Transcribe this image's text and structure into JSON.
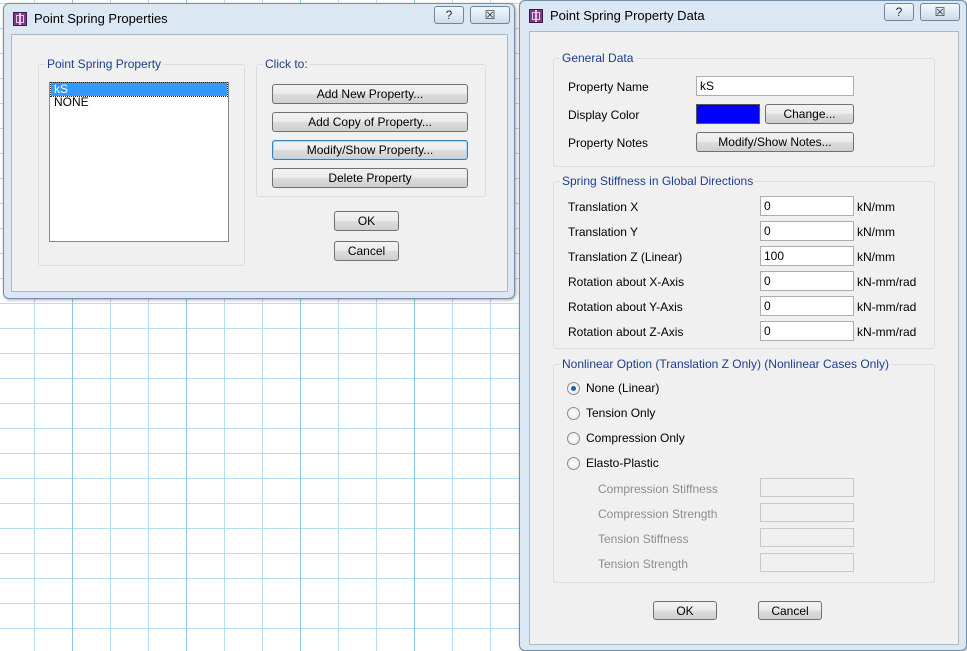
{
  "dialog1": {
    "title": "Point Spring Properties",
    "help": "?",
    "close": "☒",
    "group_property": "Point Spring Property",
    "items": [
      "kS",
      "NONE"
    ],
    "selected_index": 0,
    "group_click": "Click to:",
    "add_new": "Add New Property...",
    "add_copy": "Add Copy of Property...",
    "modify_show": "Modify/Show Property...",
    "delete": "Delete Property",
    "ok": "OK",
    "cancel": "Cancel"
  },
  "dialog2": {
    "title": "Point Spring Property Data",
    "help": "?",
    "close": "☒",
    "general": {
      "title": "General Data",
      "name_label": "Property Name",
      "name_value": "kS",
      "color_label": "Display Color",
      "color_value": "#0000ff",
      "change_button": "Change...",
      "notes_label": "Property Notes",
      "notes_button": "Modify/Show Notes..."
    },
    "stiffness": {
      "title": "Spring Stiffness in Global Directions",
      "rows": [
        {
          "label": "Translation  X",
          "value": "0",
          "unit": "kN/mm"
        },
        {
          "label": "Translation  Y",
          "value": "0",
          "unit": "kN/mm"
        },
        {
          "label": "Translation  Z  (Linear)",
          "value": "100",
          "unit": "kN/mm"
        },
        {
          "label": "Rotation about  X-Axis",
          "value": "0",
          "unit": "kN-mm/rad"
        },
        {
          "label": "Rotation about  Y-Axis",
          "value": "0",
          "unit": "kN-mm/rad"
        },
        {
          "label": "Rotation about  Z-Axis",
          "value": "0",
          "unit": "kN-mm/rad"
        }
      ]
    },
    "nonlinear": {
      "title": "Nonlinear Option  (Translation Z Only)  (Nonlinear Cases Only)",
      "options": [
        "None (Linear)",
        "Tension Only",
        "Compression Only",
        "Elasto-Plastic"
      ],
      "selected_index": 0,
      "disabled_fields": [
        {
          "label": "Compression Stiffness",
          "value": ""
        },
        {
          "label": "Compression Strength",
          "value": ""
        },
        {
          "label": "Tension Stiffness",
          "value": ""
        },
        {
          "label": "Tension Strength",
          "value": ""
        }
      ]
    },
    "ok": "OK",
    "cancel": "Cancel"
  }
}
